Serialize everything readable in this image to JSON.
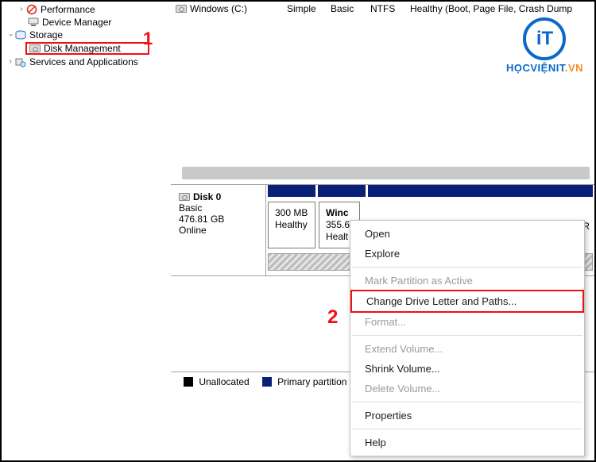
{
  "tree": {
    "perf": "Performance",
    "devmgr": "Device Manager",
    "storage": "Storage",
    "diskmgmt": "Disk Management",
    "svcapps": "Services and Applications"
  },
  "callouts": {
    "one": "1",
    "two": "2"
  },
  "volume_row": {
    "name": "Windows (C:)",
    "type": "Simple",
    "layout": "Basic",
    "fs": "NTFS",
    "status": "Healthy (Boot, Page File, Crash Dump"
  },
  "disk0": {
    "title": "Disk 0",
    "type": "Basic",
    "size": "476.81 GB",
    "state": "Online"
  },
  "partitions": {
    "p1": {
      "size": "300 MB",
      "status": "Healthy"
    },
    "p2": {
      "name": "Winc",
      "size": "355.6",
      "status": "Healt"
    },
    "trail": "(R"
  },
  "legend": {
    "unalloc": "Unallocated",
    "primary": "Primary partition"
  },
  "ctx": {
    "open": "Open",
    "explore": "Explore",
    "mark": "Mark Partition as Active",
    "change": "Change Drive Letter and Paths...",
    "format": "Format...",
    "extend": "Extend Volume...",
    "shrink": "Shrink Volume...",
    "delete": "Delete Volume...",
    "props": "Properties",
    "help": "Help"
  },
  "logo": {
    "mono": "iT",
    "brand1": "HỌCVIỆNIT",
    "brand2": ".VN"
  }
}
